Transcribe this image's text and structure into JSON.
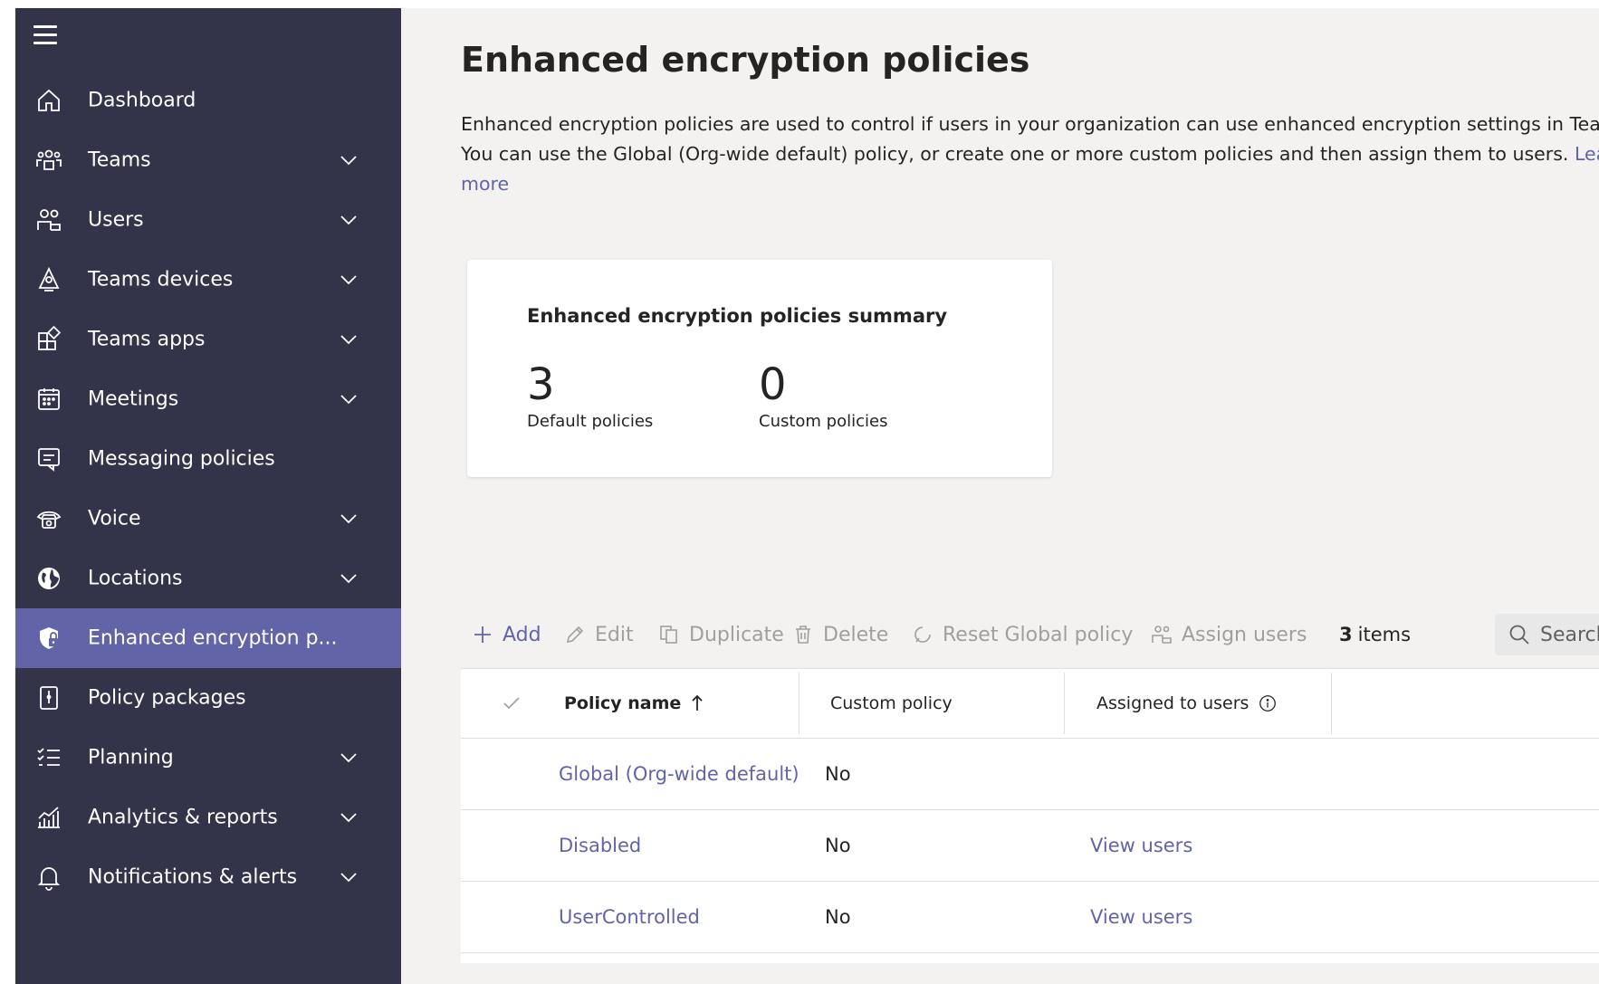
{
  "sidebar": {
    "items": [
      {
        "label": "Dashboard",
        "icon": "home-icon",
        "expandable": false,
        "active": false
      },
      {
        "label": "Teams",
        "icon": "teams-icon",
        "expandable": true,
        "active": false
      },
      {
        "label": "Users",
        "icon": "users-icon",
        "expandable": true,
        "active": false
      },
      {
        "label": "Teams devices",
        "icon": "devices-icon",
        "expandable": true,
        "active": false
      },
      {
        "label": "Teams apps",
        "icon": "apps-icon",
        "expandable": true,
        "active": false
      },
      {
        "label": "Meetings",
        "icon": "calendar-icon",
        "expandable": true,
        "active": false
      },
      {
        "label": "Messaging policies",
        "icon": "message-icon",
        "expandable": false,
        "active": false
      },
      {
        "label": "Voice",
        "icon": "phone-icon",
        "expandable": true,
        "active": false
      },
      {
        "label": "Locations",
        "icon": "globe-icon",
        "expandable": true,
        "active": false
      },
      {
        "label": "Enhanced encryption p...",
        "icon": "shield-lock-icon",
        "expandable": false,
        "active": true
      },
      {
        "label": "Policy packages",
        "icon": "package-icon",
        "expandable": false,
        "active": false
      },
      {
        "label": "Planning",
        "icon": "checklist-icon",
        "expandable": true,
        "active": false
      },
      {
        "label": "Analytics & reports",
        "icon": "analytics-icon",
        "expandable": true,
        "active": false
      },
      {
        "label": "Notifications & alerts",
        "icon": "bell-icon",
        "expandable": true,
        "active": false
      }
    ]
  },
  "page": {
    "title": "Enhanced encryption policies",
    "description_line1": "Enhanced encryption policies are used to control if users in your organization can use enhanced encryption settings in Teams.",
    "description_line2": "You can use the Global (Org-wide default) policy, or create one or more custom policies and then assign them to users.",
    "learn_more": "Learn more"
  },
  "summary": {
    "title": "Enhanced encryption policies summary",
    "default_count": "3",
    "default_label": "Default policies",
    "custom_count": "0",
    "custom_label": "Custom policies"
  },
  "toolbar": {
    "add": "Add",
    "edit": "Edit",
    "duplicate": "Duplicate",
    "delete": "Delete",
    "reset": "Reset Global policy",
    "assign": "Assign users",
    "items_count": "3",
    "items_label": "items",
    "search_placeholder": "Search"
  },
  "table": {
    "columns": {
      "policy_name": "Policy name",
      "custom_policy": "Custom policy",
      "assigned": "Assigned to users"
    },
    "rows": [
      {
        "name": "Global (Org-wide default)",
        "custom": "No",
        "assigned": ""
      },
      {
        "name": "Disabled",
        "custom": "No",
        "assigned": "View users"
      },
      {
        "name": "UserControlled",
        "custom": "No",
        "assigned": "View users"
      }
    ]
  },
  "colors": {
    "sidebar_bg": "#33344a",
    "active_bg": "#6264a7",
    "link": "#6264a7",
    "page_bg": "#f3f2f1"
  }
}
